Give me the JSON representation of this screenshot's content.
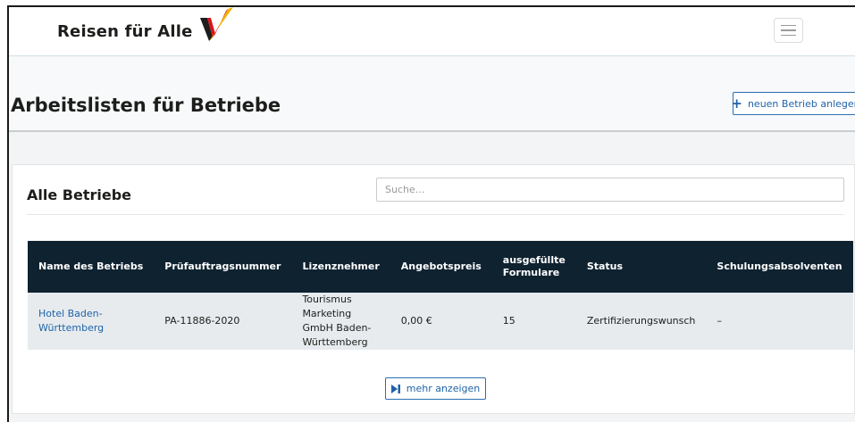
{
  "brand": {
    "name": "Reisen für Alle"
  },
  "header": {
    "title": "Arbeitslisten für Betriebe",
    "new_button_label": "neuen Betrieb anlegen"
  },
  "card": {
    "title": "Alle Betriebe",
    "search_placeholder": "Suche...",
    "more_button_label": "mehr anzeigen"
  },
  "table": {
    "columns": [
      "Name des Betriebs",
      "Prüfauftragsnummer",
      "Lizenznehmer",
      "Angebotspreis",
      "ausgefüllte Formulare",
      "Status",
      "Schulungsabsolventen"
    ],
    "rows": [
      {
        "name": "Hotel Baden-Württemberg",
        "auftrag": "PA-11886-2020",
        "lizenznehmer": "Tourismus Marketing GmbH Baden-Württemberg",
        "preis": "0,00 €",
        "formulare": "15",
        "status": "Zertifizierungswunsch",
        "absolventen": "–"
      }
    ]
  },
  "colors": {
    "table_header_bg": "#0f2230",
    "accent_blue": "#1e63a8",
    "row_bg": "#e7ebee",
    "logo_black": "#1d1d1b",
    "logo_red": "#d9151c",
    "logo_gold": "#f2b400"
  }
}
